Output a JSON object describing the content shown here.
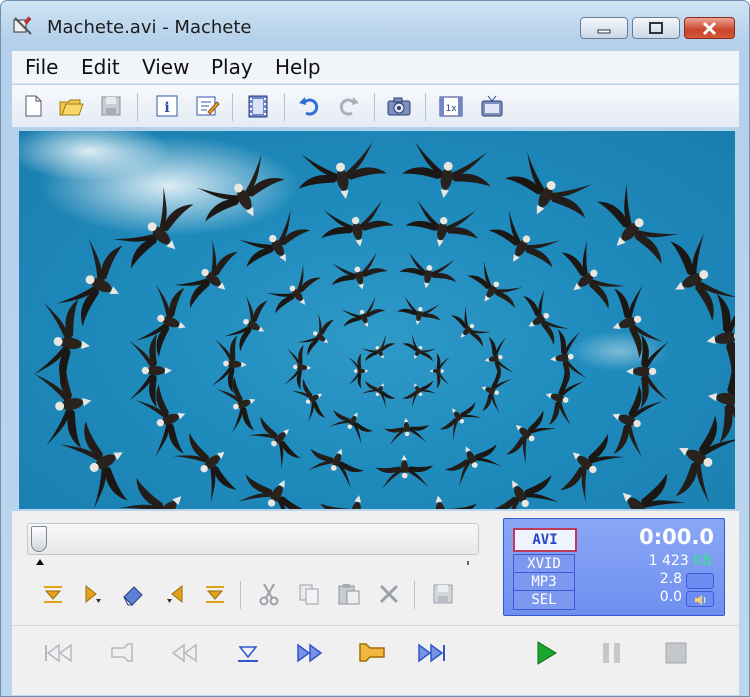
{
  "window": {
    "title": "Machete.avi - Machete"
  },
  "menu": [
    "File",
    "Edit",
    "View",
    "Play",
    "Help"
  ],
  "toolbar": [
    {
      "icon": "new-file-icon"
    },
    {
      "icon": "open-folder-icon"
    },
    {
      "icon": "save-icon"
    },
    {
      "icon": "info-icon"
    },
    {
      "icon": "edit-tags-icon"
    },
    {
      "icon": "film-icon"
    },
    {
      "icon": "undo-icon"
    },
    {
      "icon": "redo-icon"
    },
    {
      "icon": "snapshot-camera-icon"
    },
    {
      "icon": "actual-size-icon"
    },
    {
      "icon": "tv-icon"
    }
  ],
  "seek": {
    "position": 0.0
  },
  "info": {
    "format": "AVI",
    "time": "0:00.0",
    "video_codec": "XVID",
    "video_size": "1 423",
    "video_unit": "KB",
    "audio_codec": "MP3",
    "audio_value": "2.8",
    "sel_label": "SEL",
    "sel_value": "0.0"
  },
  "colors": {
    "accent": "#6f8ff0",
    "video_sky": "#1f8bbd",
    "play_green": "#1aa52b"
  }
}
